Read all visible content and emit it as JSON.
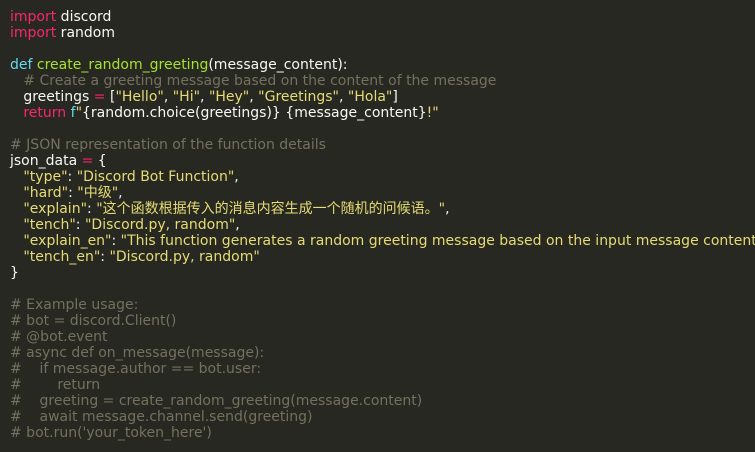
{
  "lines": [
    [
      {
        "t": "import",
        "c": "kw"
      },
      {
        "t": " discord",
        "c": "pl"
      }
    ],
    [
      {
        "t": "import",
        "c": "kw"
      },
      {
        "t": " random",
        "c": "pl"
      }
    ],
    [],
    [
      {
        "t": "def",
        "c": "def"
      },
      {
        "t": " ",
        "c": "pl"
      },
      {
        "t": "create_random_greeting",
        "c": "fn"
      },
      {
        "t": "(message_content):",
        "c": "pl"
      }
    ],
    [
      {
        "t": "   # Create a greeting message based on the content of the message",
        "c": "cmt"
      }
    ],
    [
      {
        "t": "   greetings ",
        "c": "pl"
      },
      {
        "t": "=",
        "c": "op"
      },
      {
        "t": " [",
        "c": "pl"
      },
      {
        "t": "\"Hello\"",
        "c": "str"
      },
      {
        "t": ", ",
        "c": "pl"
      },
      {
        "t": "\"Hi\"",
        "c": "str"
      },
      {
        "t": ", ",
        "c": "pl"
      },
      {
        "t": "\"Hey\"",
        "c": "str"
      },
      {
        "t": ", ",
        "c": "pl"
      },
      {
        "t": "\"Greetings\"",
        "c": "str"
      },
      {
        "t": ", ",
        "c": "pl"
      },
      {
        "t": "\"Hola\"",
        "c": "str"
      },
      {
        "t": "]",
        "c": "pl"
      }
    ],
    [
      {
        "t": "   ",
        "c": "pl"
      },
      {
        "t": "return",
        "c": "kw"
      },
      {
        "t": " f",
        "c": "def"
      },
      {
        "t": "\"",
        "c": "str"
      },
      {
        "t": "{random.choice(greetings)}",
        "c": "pl"
      },
      {
        "t": " ",
        "c": "str"
      },
      {
        "t": "{message_content}",
        "c": "pl"
      },
      {
        "t": "!\"",
        "c": "str"
      }
    ],
    [],
    [
      {
        "t": "# JSON representation of the function details",
        "c": "cmt"
      }
    ],
    [
      {
        "t": "json_data ",
        "c": "pl"
      },
      {
        "t": "=",
        "c": "op"
      },
      {
        "t": " {",
        "c": "pl"
      }
    ],
    [
      {
        "t": "   ",
        "c": "pl"
      },
      {
        "t": "\"type\"",
        "c": "str"
      },
      {
        "t": ": ",
        "c": "pl"
      },
      {
        "t": "\"Discord Bot Function\"",
        "c": "str"
      },
      {
        "t": ",",
        "c": "pl"
      }
    ],
    [
      {
        "t": "   ",
        "c": "pl"
      },
      {
        "t": "\"hard\"",
        "c": "str"
      },
      {
        "t": ": ",
        "c": "pl"
      },
      {
        "t": "\"中级\"",
        "c": "str"
      },
      {
        "t": ",",
        "c": "pl"
      }
    ],
    [
      {
        "t": "   ",
        "c": "pl"
      },
      {
        "t": "\"explain\"",
        "c": "str"
      },
      {
        "t": ": ",
        "c": "pl"
      },
      {
        "t": "\"这个函数根据传入的消息内容生成一个随机的问候语。\"",
        "c": "str"
      },
      {
        "t": ",",
        "c": "pl"
      }
    ],
    [
      {
        "t": "   ",
        "c": "pl"
      },
      {
        "t": "\"tench\"",
        "c": "str"
      },
      {
        "t": ": ",
        "c": "pl"
      },
      {
        "t": "\"Discord.py, random\"",
        "c": "str"
      },
      {
        "t": ",",
        "c": "pl"
      }
    ],
    [
      {
        "t": "   ",
        "c": "pl"
      },
      {
        "t": "\"explain_en\"",
        "c": "str"
      },
      {
        "t": ": ",
        "c": "pl"
      },
      {
        "t": "\"This function generates a random greeting message based on the input message content.\"",
        "c": "str"
      },
      {
        "t": ",",
        "c": "pl"
      }
    ],
    [
      {
        "t": "   ",
        "c": "pl"
      },
      {
        "t": "\"tench_en\"",
        "c": "str"
      },
      {
        "t": ": ",
        "c": "pl"
      },
      {
        "t": "\"Discord.py, random\"",
        "c": "str"
      }
    ],
    [
      {
        "t": "}",
        "c": "pl"
      }
    ],
    [],
    [
      {
        "t": "# Example usage:",
        "c": "cmt"
      }
    ],
    [
      {
        "t": "# bot = discord.Client()",
        "c": "cmt"
      }
    ],
    [
      {
        "t": "# @bot.event",
        "c": "cmt"
      }
    ],
    [
      {
        "t": "# async def on_message(message):",
        "c": "cmt"
      }
    ],
    [
      {
        "t": "#    if message.author == bot.user:",
        "c": "cmt"
      }
    ],
    [
      {
        "t": "#        return",
        "c": "cmt"
      }
    ],
    [
      {
        "t": "#    greeting = create_random_greeting(message.content)",
        "c": "cmt"
      }
    ],
    [
      {
        "t": "#    await message.channel.send(greeting)",
        "c": "cmt"
      }
    ],
    [
      {
        "t": "# bot.run('your_token_here')",
        "c": "cmt"
      }
    ]
  ]
}
